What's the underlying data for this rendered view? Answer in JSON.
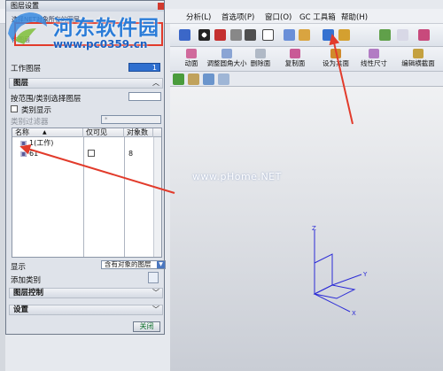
{
  "dialog": {
    "title": "图层设置",
    "hint": "选择NET对象所在的图层",
    "hint2": "件图层",
    "work_layer_label": "工作图层",
    "work_layer_value": "1",
    "section_layers": "图层",
    "select_by_range_label": "按范围/类别选择图层",
    "class_display_label": "类别显示",
    "class_filter_label": "类别过滤器",
    "class_filter_value": "*",
    "table": {
      "columns": [
        "名称",
        "仅可见",
        "对象数"
      ],
      "rows": [
        {
          "name": "1(工作)",
          "visible_only": "",
          "count": ""
        },
        {
          "name": "61",
          "visible_only": "",
          "count": "8"
        }
      ]
    },
    "display_label": "显示",
    "display_value": "含有对象的图层",
    "add_class_label": "添加类别",
    "section_layer_control": "图层控制",
    "section_settings": "设置",
    "close_button": "关闭"
  },
  "menu": [
    "分析(L)",
    "首选项(P)",
    "窗口(O)",
    "GC 工具箱",
    "帮助(H)"
  ],
  "toolbar_buttons": [
    "动面",
    "调整圆角大小",
    "删除面",
    "复制面",
    "设为共面",
    "线性尺寸",
    "编辑横截面"
  ],
  "watermarks": {
    "title": "河东软件园",
    "url": "www.pc0359.cn",
    "center": "www.pHome.NET"
  },
  "triad": {
    "z": "Z",
    "y": "Y",
    "x": "X"
  },
  "colors": {
    "accent": "#2f6fcf",
    "annotation": "#e23b2b",
    "watermark": "#2a7cd8"
  }
}
